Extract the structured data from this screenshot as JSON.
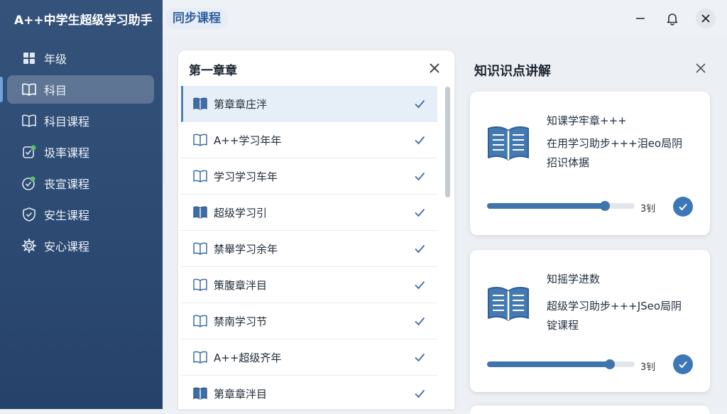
{
  "app": {
    "title": "A++中学生超级学习助手",
    "title_highlight": "同步课程"
  },
  "sidebar": {
    "items": [
      {
        "label": "年级",
        "icon": "grid-icon"
      },
      {
        "label": "科目",
        "icon": "book-icon",
        "active": true
      },
      {
        "label": "科目课程",
        "icon": "book-icon"
      },
      {
        "label": "圾率课程",
        "icon": "edit-check-icon"
      },
      {
        "label": "丧宣课程",
        "icon": "check-circle-icon"
      },
      {
        "label": "安生课程",
        "icon": "shield-icon"
      },
      {
        "label": "安心课程",
        "icon": "gear-icon"
      }
    ]
  },
  "chapter_panel": {
    "title": "第一章章",
    "items": [
      {
        "label": "第章章庄泮",
        "selected": true
      },
      {
        "label": "A++学习年年"
      },
      {
        "label": "学习学习车年"
      },
      {
        "label": "超级学习引"
      },
      {
        "label": "禁舉学习余年"
      },
      {
        "label": "策腹章泮目"
      },
      {
        "label": "禁南学习节"
      },
      {
        "label": "A++超级齐年"
      },
      {
        "label": "第章章泮目"
      }
    ]
  },
  "knowledge_panel": {
    "title": "知识识点讲解",
    "cards": [
      {
        "line1": "知课学牢章+++",
        "line2": "在用学习助步+++泪eo局阴",
        "line3": "招识体据",
        "progress": 0.8,
        "progress_label": "3钊"
      },
      {
        "line1": "知摇学进数",
        "line2": "超级学习助步+++JSeo局阴",
        "line3": "锭课程",
        "progress": 0.83,
        "progress_label": "3钊"
      }
    ]
  },
  "colors": {
    "sidebar": "#2c4a72",
    "accent": "#3f74ad",
    "selected_row": "#e6eef7"
  }
}
